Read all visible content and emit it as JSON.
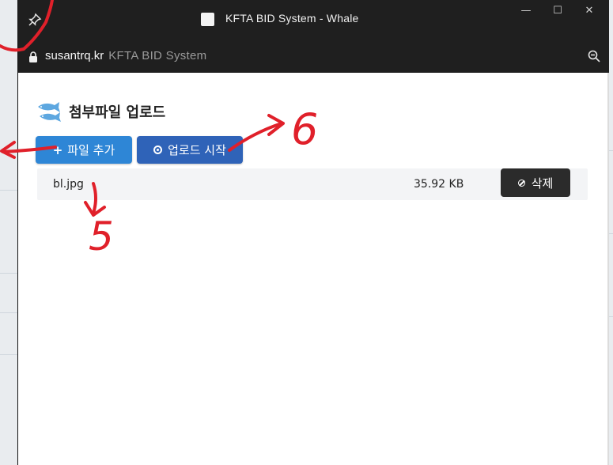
{
  "window": {
    "title": "KFTA BID System - Whale",
    "controls": {
      "minimize": "—",
      "maximize": "☐",
      "close": "✕"
    }
  },
  "address_bar": {
    "domain": "susantrq.kr",
    "page_title": "KFTA BID System"
  },
  "uploader": {
    "heading": "첨부파일 업로드",
    "add_button": {
      "icon": "+",
      "label": "파일 추가"
    },
    "upload_button": {
      "label": "업로드 시작"
    },
    "files": [
      {
        "name": "bl.jpg",
        "size": "35.92 KB",
        "delete_label": "삭제"
      }
    ]
  },
  "annotations": {
    "number_5": "5",
    "number_6": "6",
    "color": "#e0202a"
  },
  "icons": [
    "pin-icon",
    "app-icon",
    "lock-icon",
    "zoom-icon",
    "fish-icon",
    "plus-icon",
    "upload-circle-icon",
    "ban-icon"
  ],
  "colors": {
    "add_button": "#2e86d6",
    "upload_button": "#2f63b8",
    "delete_button": "#2b2b2b",
    "titlebar": "#1f1f1f"
  }
}
